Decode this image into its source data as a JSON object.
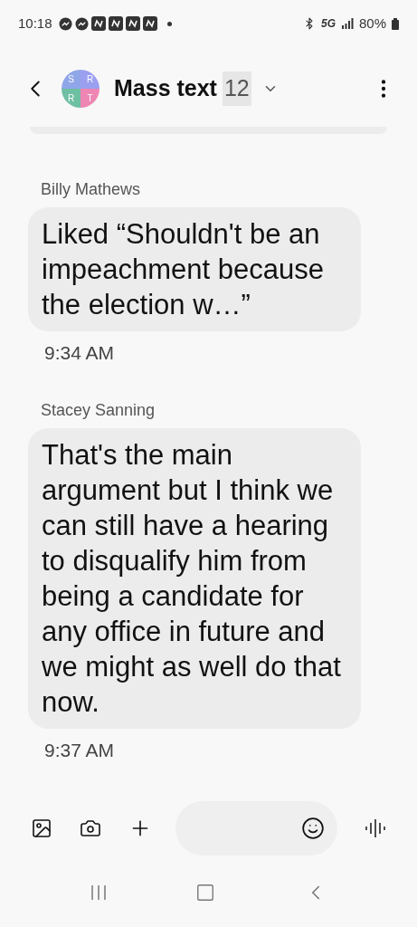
{
  "status_bar": {
    "time": "10:18",
    "notifications": [
      {
        "kind": "messenger"
      },
      {
        "kind": "messenger"
      },
      {
        "kind": "n"
      },
      {
        "kind": "n"
      },
      {
        "kind": "n"
      },
      {
        "kind": "n"
      },
      {
        "kind": "dot"
      }
    ],
    "network": "5G",
    "battery": "80%"
  },
  "header": {
    "avatar": [
      {
        "letter": "S",
        "color": "#8fa6e8"
      },
      {
        "letter": "R",
        "color": "#9b9ff0"
      },
      {
        "letter": "R",
        "color": "#6fbfa3"
      },
      {
        "letter": "T",
        "color": "#ee86b4"
      }
    ],
    "title": "Mass text",
    "count": "12"
  },
  "messages": [
    {
      "sender": "Billy Mathews",
      "text": "Liked “Shouldn't be an impeachment because the election w…”",
      "time": "9:34 AM"
    },
    {
      "sender": "Stacey Sanning",
      "text": "That's the main argument but I think we can still have a hearing to disqualify him from being a candidate for any office in future and we might as well do that now.",
      "time": "9:37 AM"
    }
  ]
}
